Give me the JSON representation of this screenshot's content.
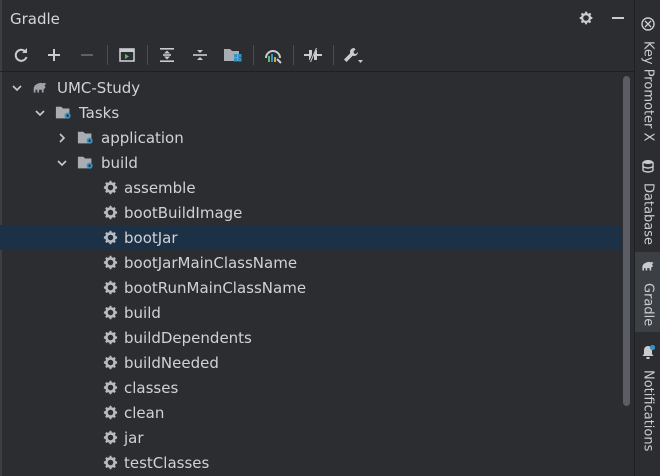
{
  "panel": {
    "title": "Gradle"
  },
  "toolbar": {
    "buttons": [
      {
        "name": "refresh-icon"
      },
      {
        "name": "add-icon"
      },
      {
        "name": "remove-icon"
      },
      {
        "name": "run-config-icon"
      },
      {
        "name": "expand-all-icon"
      },
      {
        "name": "collapse-all-icon"
      },
      {
        "name": "group-modules-icon"
      },
      {
        "name": "analyze-dependencies-icon"
      },
      {
        "name": "toggle-offline-icon"
      },
      {
        "name": "build-settings-icon"
      }
    ]
  },
  "tree": {
    "root": "UMC-Study",
    "tasks": "Tasks",
    "application": "application",
    "build": "build",
    "build_tasks": [
      "assemble",
      "bootBuildImage",
      "bootJar",
      "bootJarMainClassName",
      "bootRunMainClassName",
      "build",
      "buildDependents",
      "buildNeeded",
      "classes",
      "clean",
      "jar",
      "testClasses"
    ],
    "selected": "bootJar"
  },
  "side_tabs": [
    {
      "label": "Key Promoter X",
      "icon": "key-promoter-icon"
    },
    {
      "label": "Database",
      "icon": "database-icon"
    },
    {
      "label": "Gradle",
      "icon": "gradle-elephant-icon",
      "active": true
    },
    {
      "label": "Notifications",
      "icon": "bell-icon"
    }
  ],
  "colors": {
    "background": "#2b2d30",
    "selection": "#1d3146",
    "accent": "#3592c4",
    "text": "#d0d2d6"
  }
}
